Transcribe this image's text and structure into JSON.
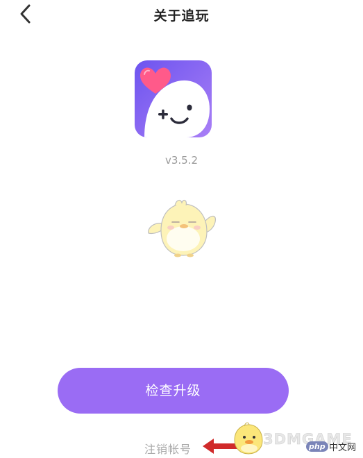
{
  "header": {
    "title": "关于追玩",
    "back_icon": "chevron-left-icon"
  },
  "app": {
    "icon_name": "app-logo-icon",
    "version": "v3.5.2"
  },
  "illustration": {
    "icon_name": "mascot-duck-icon"
  },
  "actions": {
    "check_update_label": "检查升级",
    "cancel_account_label": "注销帐号"
  },
  "watermark": {
    "site_text": "3DMGAME",
    "php_badge": "php",
    "cn_text": "中文网"
  },
  "colors": {
    "accent": "#9a6cf4",
    "icon_gradient_start": "#7b5cf0",
    "icon_gradient_end": "#a67cf7",
    "heart": "#ff5a8a",
    "muted_text": "#9a9a9a",
    "arrow": "#d02a2a"
  }
}
